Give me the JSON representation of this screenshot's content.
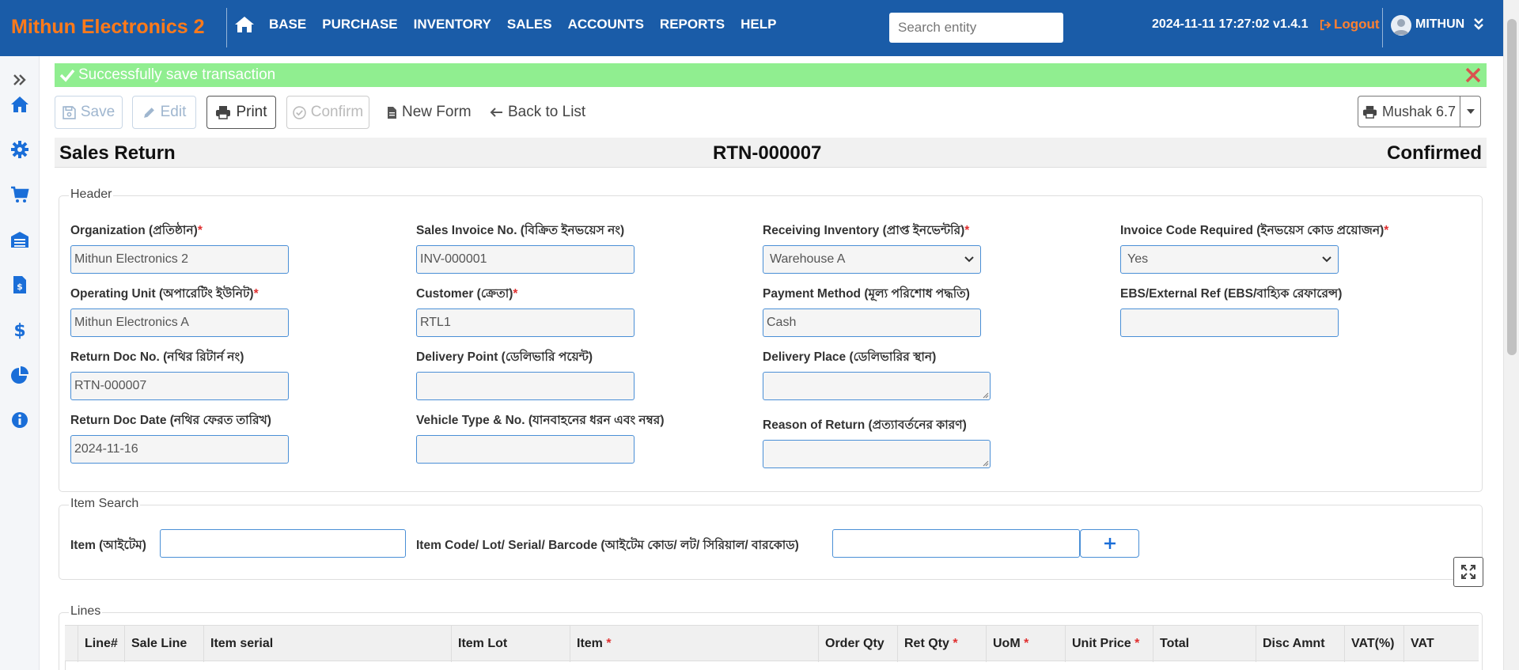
{
  "app": {
    "brand": "Mithun Electronics 2",
    "nav_items": [
      "BASE",
      "PURCHASE",
      "INVENTORY",
      "SALES",
      "ACCOUNTS",
      "REPORTS",
      "HELP"
    ],
    "search_placeholder": "Search entity",
    "datetime_version": "2024-11-11 17:27:02 v1.4.1",
    "logout_label": "Logout",
    "username": "MITHUN",
    "brand_color": "#ff7a1a",
    "navbar_color": "#1a5ca8"
  },
  "sidebar": {
    "icons": [
      "chevrons-right-icon",
      "home-icon",
      "gear-icon",
      "cart-icon",
      "warehouse-icon",
      "invoice-icon",
      "dollar-icon",
      "pie-chart-icon",
      "info-icon"
    ]
  },
  "alert": {
    "message": "Successfully save transaction",
    "color": "#90ee90"
  },
  "toolbar": {
    "save_label": "Save",
    "edit_label": "Edit",
    "print_label": "Print",
    "confirm_label": "Confirm",
    "new_form_label": "New Form",
    "back_label": "Back to List",
    "mushak_label": "Mushak 6.7"
  },
  "document": {
    "title": "Sales Return",
    "number": "RTN-000007",
    "status": "Confirmed"
  },
  "header_section": {
    "legend": "Header",
    "fields": {
      "organization": {
        "label": "Organization (প্রতিষ্ঠান)",
        "required": "*",
        "value": "Mithun Electronics 2"
      },
      "operating_unit": {
        "label": "Operating Unit (অপারেটিং ইউনিট)",
        "required": "*",
        "value": "Mithun Electronics A"
      },
      "return_doc_no": {
        "label": "Return Doc No. (নথির রিটার্ন নং)",
        "value": "RTN-000007"
      },
      "return_doc_date": {
        "label": "Return Doc Date (নথির ফেরত তারিখ)",
        "value": "2024-11-16"
      },
      "sales_invoice_no": {
        "label": "Sales Invoice No. (বিক্রিত ইনভয়েস নং)",
        "value": "INV-000001"
      },
      "customer": {
        "label": "Customer (ক্রেতা)",
        "required": "*",
        "value": "RTL1"
      },
      "delivery_point": {
        "label": "Delivery Point (ডেলিভারি পয়েন্ট)",
        "value": ""
      },
      "vehicle": {
        "label": "Vehicle Type & No. (যানবাহনের ধরন এবং নম্বর)",
        "value": ""
      },
      "receiving_inventory": {
        "label": "Receiving Inventory (প্রাপ্ত ইনভেন্টরি)",
        "required": "*",
        "value": "Warehouse A"
      },
      "payment_method": {
        "label": "Payment Method (মূল্য পরিশোধ পদ্ধতি)",
        "value": "Cash"
      },
      "delivery_place": {
        "label": "Delivery Place (ডেলিভারির স্থান)",
        "value": ""
      },
      "reason_of_return": {
        "label": "Reason of Return (প্রত্যাবর্তনের কারণ)",
        "value": ""
      },
      "invoice_code_required": {
        "label": "Invoice Code Required (ইনভয়েস কোড প্রয়োজন)",
        "required": "*",
        "value": "Yes"
      },
      "ebs_external_ref": {
        "label": "EBS/External Ref (EBS/বাহ্যিক রেফারেন্স)",
        "value": ""
      }
    }
  },
  "item_search": {
    "legend": "Item Search",
    "item_label": "Item (আইটেম)",
    "code_label": "Item Code/ Lot/ Serial/ Barcode (আইটেম কোড/ লট/ সিরিয়াল/ বারকোড)",
    "add_icon": "plus-icon"
  },
  "lines": {
    "legend": "Lines",
    "columns": [
      {
        "label": "Line#",
        "required": ""
      },
      {
        "label": "Sale Line",
        "required": ""
      },
      {
        "label": "Item serial",
        "required": ""
      },
      {
        "label": "Item Lot",
        "required": ""
      },
      {
        "label": "Item",
        "required": "*"
      },
      {
        "label": "Order Qty",
        "required": ""
      },
      {
        "label": "Ret Qty",
        "required": "*"
      },
      {
        "label": "UoM",
        "required": "*"
      },
      {
        "label": "Unit Price",
        "required": "*"
      },
      {
        "label": "Total",
        "required": ""
      },
      {
        "label": "Disc Amnt",
        "required": ""
      },
      {
        "label": "VAT(%)",
        "required": ""
      },
      {
        "label": "VAT",
        "required": ""
      }
    ]
  }
}
